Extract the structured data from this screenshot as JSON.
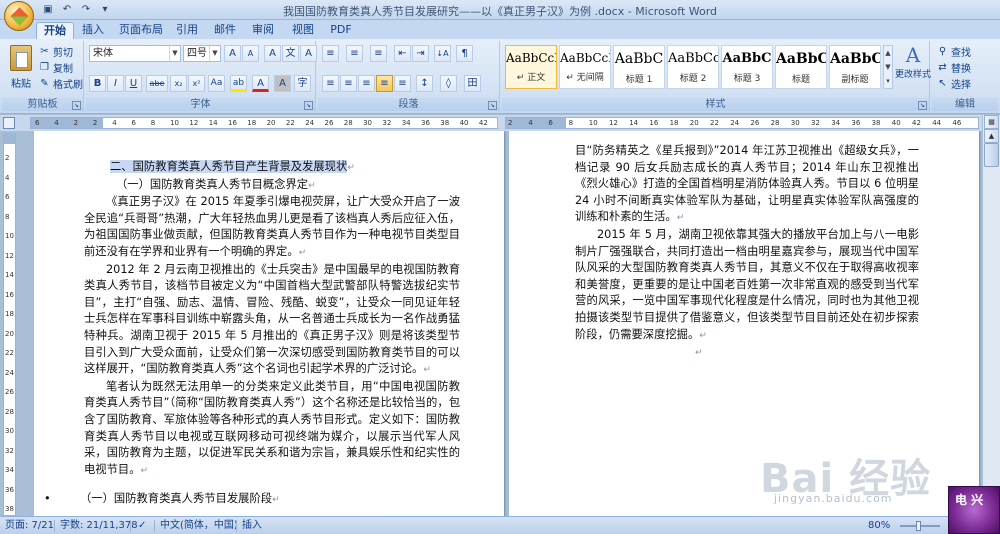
{
  "window": {
    "title": "我国国防教育类真人秀节目发展研究——以《真正男子汉》为例 .docx - Microsoft Word"
  },
  "quick_access": {
    "save_icon": "save-icon",
    "undo_icon": "undo-icon",
    "redo_icon": "redo-icon",
    "customize_icon": "customize-icon"
  },
  "tabs": [
    "开始",
    "插入",
    "页面布局",
    "引用",
    "邮件",
    "审阅",
    "视图",
    "PDF"
  ],
  "ribbon": {
    "clipboard": {
      "paste": "粘贴",
      "cut": "剪切",
      "copy": "复制",
      "format_painter": "格式刷",
      "label": "剪贴板"
    },
    "font": {
      "font_name": "宋体",
      "font_size": "四号",
      "grow": "A",
      "shrink": "A",
      "clear": "A",
      "wen": "文",
      "bold": "B",
      "italic": "I",
      "underline": "U",
      "strike": "abe",
      "subscript": "x₂",
      "superscript": "x²",
      "change_case": "Aa",
      "highlight": "ab",
      "font_color": "A",
      "char_shading": "A",
      "char_border": "A",
      "phonetic": "字",
      "label": "字体"
    },
    "paragraph": {
      "label": "段落",
      "bullets": "≡",
      "numbering": "≡",
      "multilevel": "≡",
      "decrease_indent": "⇤",
      "increase_indent": "⇥",
      "sort": "↓A",
      "show_marks": "¶",
      "align_left": "≡",
      "center": "≡",
      "align_right": "≡",
      "justify": "≡",
      "distributed": "≡",
      "line_spacing": "↕",
      "shading": "◊",
      "borders": "田"
    },
    "styles": {
      "label": "样式",
      "items": [
        {
          "preview": "AaBbCcI",
          "name": "↵ 正文"
        },
        {
          "preview": "AaBbCcI",
          "name": "↵ 无间隔"
        },
        {
          "preview": "AaBbC",
          "name": "标题 1"
        },
        {
          "preview": "AaBbCc",
          "name": "标题 2"
        },
        {
          "preview": "AaBbC",
          "name": "标题 3"
        },
        {
          "preview": "AaBbC",
          "name": "标题"
        },
        {
          "preview": "AaBbC",
          "name": "副标题"
        }
      ],
      "change_styles": "更改样式"
    },
    "editing": {
      "label": "编辑",
      "find": "查找",
      "replace": "替换",
      "select": "选择"
    }
  },
  "ruler": {
    "left_numbers": [
      "6",
      "4",
      "2",
      "2",
      "4",
      "6",
      "8",
      "10",
      "12",
      "14",
      "16",
      "18",
      "20",
      "22",
      "24",
      "26",
      "28",
      "30",
      "32",
      "34",
      "36",
      "38",
      "40",
      "42"
    ],
    "right_numbers": [
      "2",
      "4",
      "6",
      "8",
      "10",
      "12",
      "14",
      "16",
      "18",
      "20",
      "22",
      "24",
      "26",
      "28",
      "30",
      "32",
      "34",
      "36",
      "38",
      "40",
      "42",
      "44",
      "46"
    ],
    "vertical_numbers": [
      "2",
      "4",
      "6",
      "8",
      "10",
      "12",
      "14",
      "16",
      "18",
      "20",
      "22",
      "24",
      "26",
      "28",
      "30",
      "32",
      "34",
      "36",
      "38"
    ]
  },
  "document": {
    "left_page": {
      "heading": "二、国防教育类真人秀节目产生背景及发展现状",
      "subheading": "（一）国防教育类真人秀节目概念界定",
      "p1": "《真正男子汉》在 2015 年夏季引爆电视荧屏，让广大受众开启了一波全民追“兵哥哥”热潮，广大年轻热血男儿更是看了该档真人秀后应征入伍，为祖国国防事业做贡献，但国防教育类真人秀节目作为一种电视节目类型目前还没有在学界和业界有一个明确的界定。",
      "p2": "2012 年 2 月云南卫视推出的《士兵突击》是中国最早的电视国防教育类真人秀节目，该档节目被定义为“中国首档大型武警部队特警选拔纪实节目”，主打“自强、励志、温情、冒险、残酷、蜕变”，让受众一同见证年轻士兵怎样在军事科目训练中崭露头角，从一名普通士兵成长为一名作战勇猛特种兵。湖南卫视于 2015 年 5 月推出的《真正男子汉》则是将该类型节目引入到广大受众面前，让受众们第一次深切感受到国防教育类节目的可以这样展开，“国防教育类真人秀”这个名词也引起学术界的广泛讨论。",
      "p3": "笔者认为既然无法用单一的分类来定义此类节目，用“中国电视国防教育类真人秀节目”（简称“国防教育类真人秀”）这个名称还是比较恰当的，包含了国防教育、军旅体验等各种形式的真人秀节目形式。定义如下：国防教育类真人秀节目以电视或互联网移动可视终端为媒介，以展示当代军人风采，国防教育为主题，以促进军民关系和谐为宗旨，兼具娱乐性和纪实性的电视节目。",
      "bullet": "•",
      "subheading2": "（一）国防教育类真人秀节目发展阶段"
    },
    "right_page": {
      "p1": "目“防务精英之《星兵报到》”2014 年江苏卫视推出《超级女兵》，一档记录 90 后女兵励志成长的真人秀节目；2014 年山东卫视推出《烈火雄心》打造的全国首档明星消防体验真人秀。节目以 6 位明星 24 小时不间断真实体验军队为基础，让明星真实体验军队高强度的训练和朴素的生活。",
      "p2": "2015 年 5 月，湖南卫视依靠其强大的播放平台加上与八一电影制片厂强强联合，共同打造出一档由明星嘉宾参与，展现当代中国军队风采的大型国防教育类真人秀节目，其意义不仅在于取得高收视率和美誉度，更重要的是让中国老百姓第一次非常直观的感受到当代军营的风采，一览中国军事现代化程度是什么情况，同时也为其他卫视拍摄该类型节目提供了借鉴意义，但该类型节目目前还处在初步探索阶段，仍需要深度挖掘。"
    }
  },
  "status": {
    "page": "页面: 7/21",
    "words": "字数: 21/11,378",
    "language": "中文(简体，中国)",
    "mode": "插入",
    "zoom": "80%"
  },
  "watermark": {
    "logo": "Bai 经验",
    "url": "jingyan.baidu.com",
    "corner": "电 兴"
  },
  "colors": {
    "title_bar": "#c2d6ee",
    "ribbon": "#d3e2f3",
    "workspace": "#a9bfd6",
    "selection": "#c6d8f3",
    "accent_text": "#15428b"
  }
}
